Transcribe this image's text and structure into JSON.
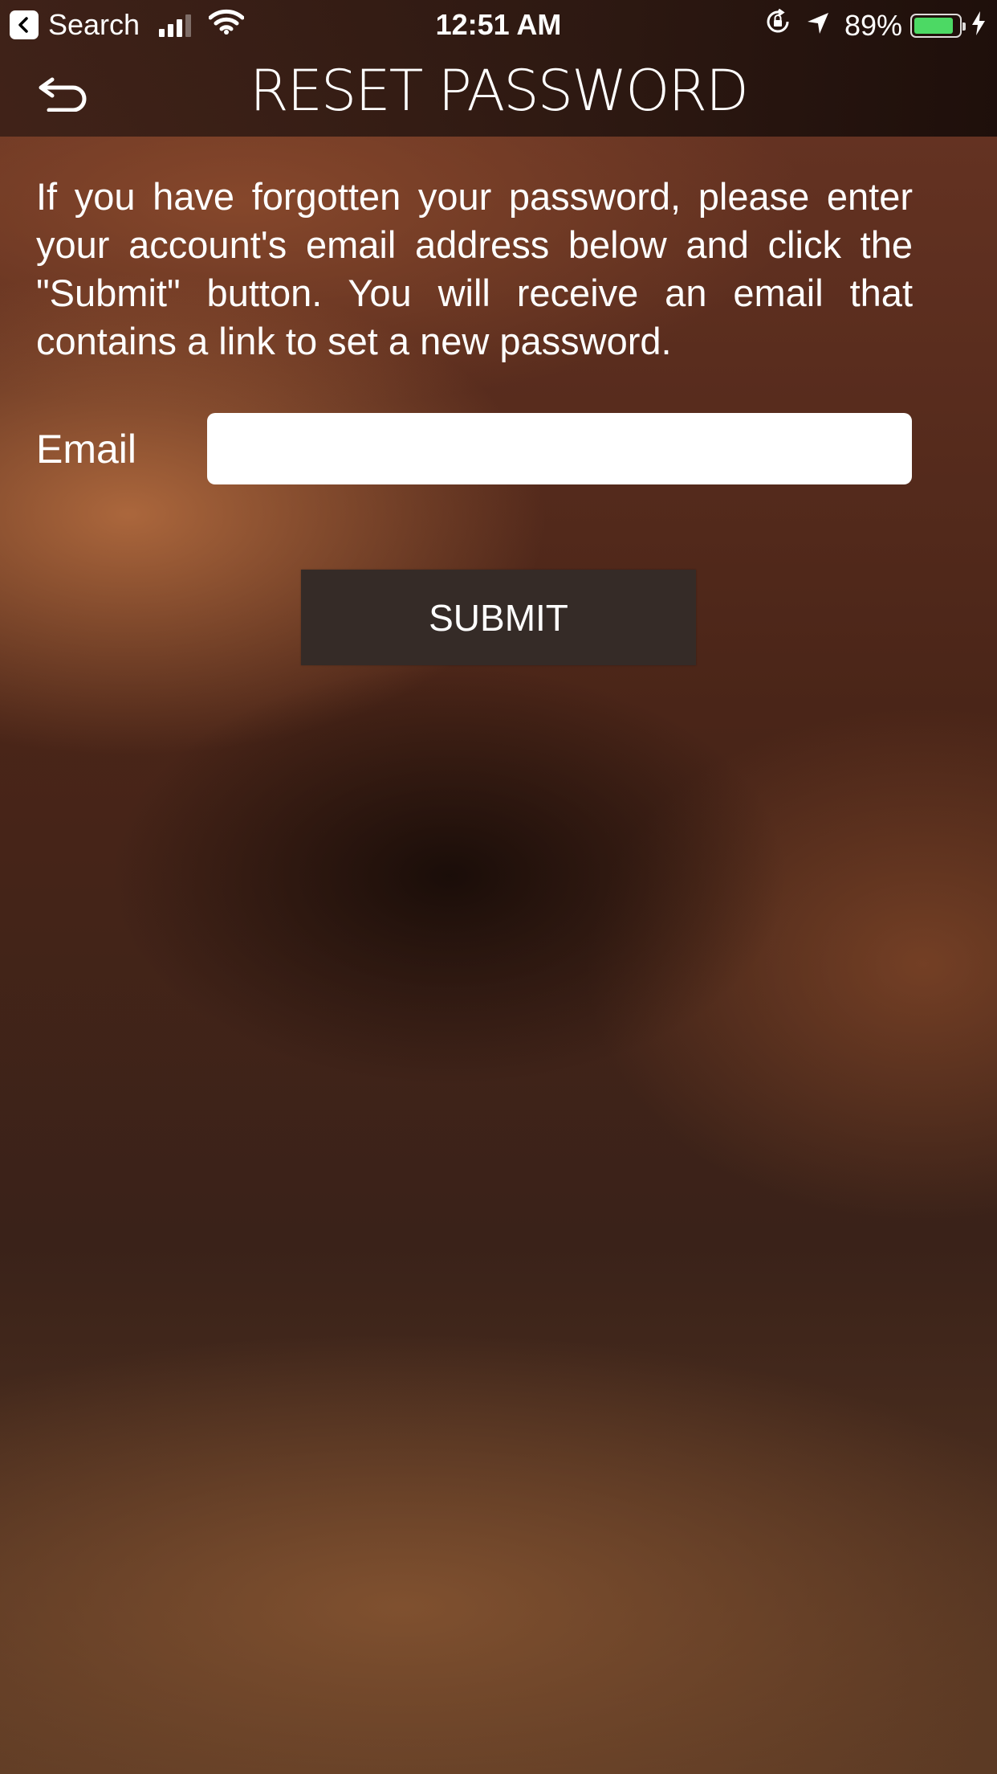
{
  "status_bar": {
    "back_app_label": "Search",
    "time": "12:51 AM",
    "battery_percent": "89%",
    "battery_level": 0.89,
    "battery_color": "#4cd964"
  },
  "header": {
    "title": "RESET PASSWORD",
    "back_icon": "return-arrow-icon"
  },
  "form": {
    "instructions": "If you have forgotten your password, please enter your account's email address below and click the \"Submit\" button. You will receive an email that contains a link to set a new password.",
    "email_label": "Email",
    "email_value": "",
    "submit_label": "SUBMIT"
  }
}
